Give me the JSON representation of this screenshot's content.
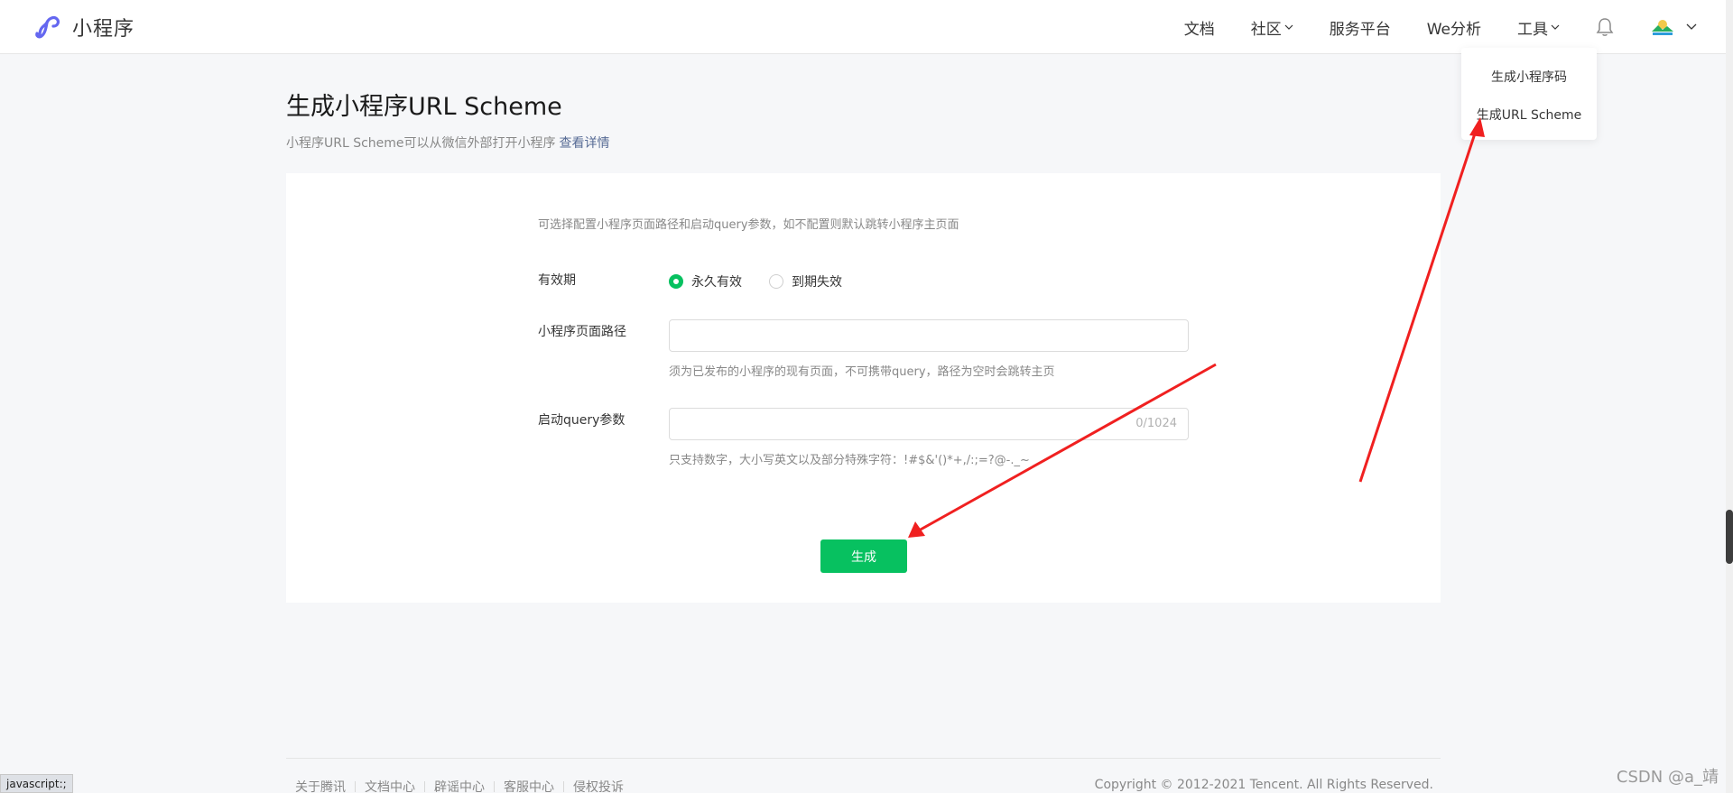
{
  "header": {
    "logo_text": "小程序",
    "nav": {
      "docs": "文档",
      "community": "社区",
      "service_platform": "服务平台",
      "we_analytics": "We分析",
      "tools": "工具"
    },
    "icons": [
      "logo-icon",
      "chevron-down-icon",
      "bell-icon",
      "avatar",
      "chevron-down-icon"
    ]
  },
  "tools_menu": {
    "items": [
      "生成小程序码",
      "生成URL Scheme"
    ]
  },
  "page": {
    "title": "生成小程序URL Scheme",
    "description": "小程序URL Scheme可以从微信外部打开小程序",
    "detail_link": "查看详情"
  },
  "form": {
    "hint": "可选择配置小程序页面路径和启动query参数，如不配置则默认跳转小程序主页面",
    "validity": {
      "label": "有效期",
      "options": [
        "永久有效",
        "到期失效"
      ],
      "selected": "永久有效"
    },
    "path": {
      "label": "小程序页面路径",
      "value": "",
      "help": "须为已发布的小程序的现有页面，不可携带query，路径为空时会跳转主页"
    },
    "query": {
      "label": "启动query参数",
      "value": "",
      "counter": "0/1024",
      "help": "只支持数字，大小写英文以及部分特殊字符：!#$&'()*+,/:;=?@-._~"
    },
    "submit_label": "生成"
  },
  "footer": {
    "links": [
      "关于腾讯",
      "文档中心",
      "辟谣中心",
      "客服中心",
      "侵权投诉"
    ],
    "copyright": "Copyright © 2012-2021 Tencent. All Rights Reserved."
  },
  "status_bar": "javascript:;",
  "watermark": "CSDN @a_靖",
  "colors": {
    "accent": "#07c160",
    "link": "#576b95",
    "annotation_arrow": "#f02020"
  }
}
